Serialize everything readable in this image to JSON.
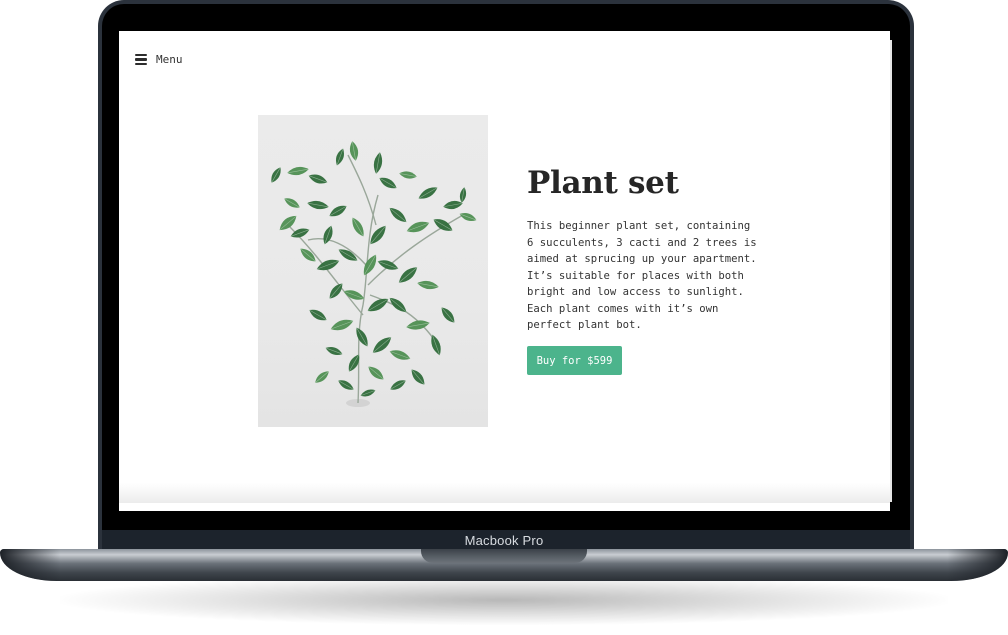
{
  "device": {
    "brand_label": "Macbook Pro"
  },
  "nav": {
    "menu_label": "Menu",
    "menu_icon": "hamburger-icon"
  },
  "product": {
    "image_subject": "plant-photo",
    "title": "Plant set",
    "description_lines": [
      "This beginner plant set, containing",
      "6 succulents, 3 cacti and 2 trees is",
      "aimed at sprucing up your apartment.",
      "It’s suitable for places with both",
      "bright and low access to sunlight.",
      "Each plant comes with it’s own",
      "perfect plant bot."
    ],
    "buy_label": "Buy for $599"
  },
  "colors": {
    "accent": "#4cb48c",
    "text": "#262626",
    "laptop_frame": "#2b323c",
    "leaf_dark": "#2f6b3a",
    "leaf_light": "#4f8f52"
  }
}
